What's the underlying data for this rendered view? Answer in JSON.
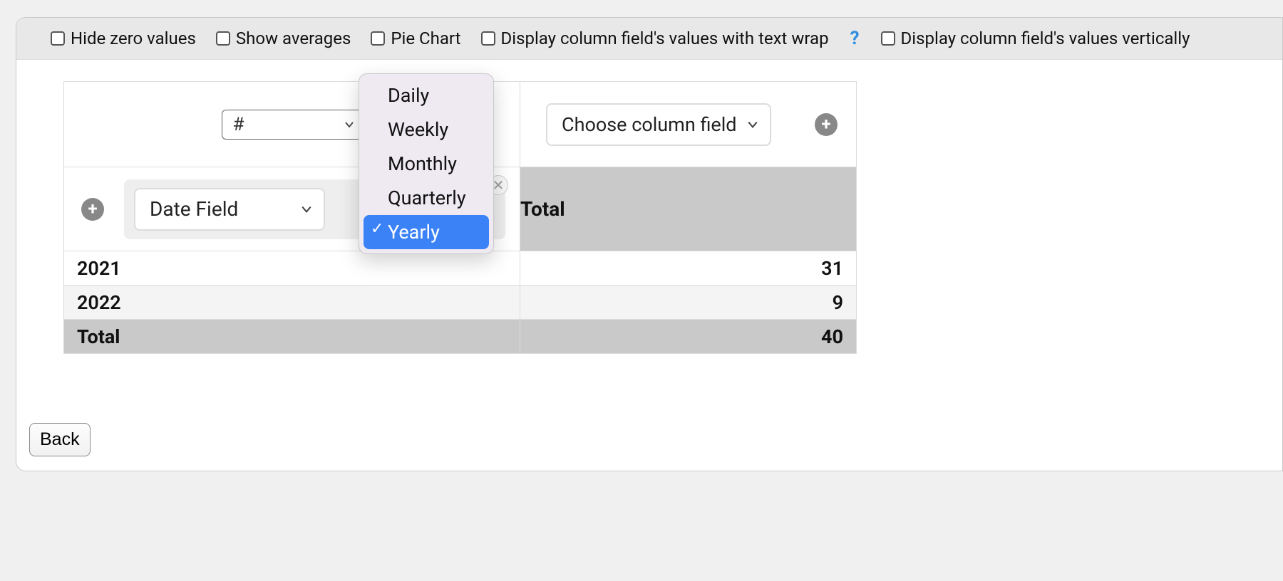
{
  "toolbar": {
    "hide_zero": "Hide zero values",
    "show_avg": "Show averages",
    "pie_chart": "Pie Chart",
    "text_wrap": "Display column field's values with text wrap",
    "vertical": "Display column field's values vertically"
  },
  "selects": {
    "hash_prefix": "#",
    "column_field": "Choose column field",
    "row_field": "Date Field"
  },
  "period_menu": {
    "items": [
      "Daily",
      "Weekly",
      "Monthly",
      "Quarterly",
      "Yearly"
    ],
    "selected": "Yearly"
  },
  "table": {
    "total_label": "Total",
    "rows": [
      {
        "label": "2021",
        "value": "31"
      },
      {
        "label": "2022",
        "value": "9"
      }
    ],
    "grand_total_label": "Total",
    "grand_total_value": "40"
  },
  "buttons": {
    "back": "Back"
  }
}
